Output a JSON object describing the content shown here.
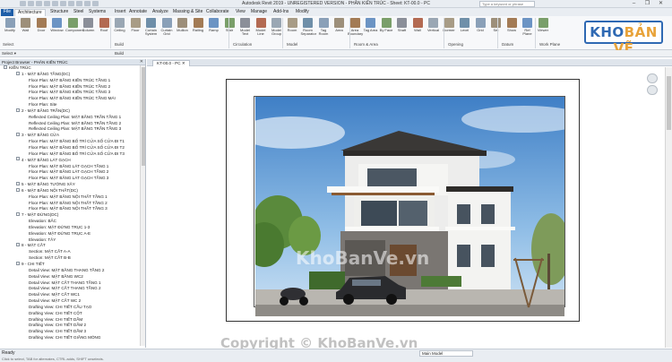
{
  "app": {
    "title": "Autodesk Revit 2019 - UNREGISTERED VERSION - PHÂN KIẾN TRÚC - Sheet: KT-00.0 - PC",
    "search_placeholder": "Type a keyword or phrase"
  },
  "window_controls": {
    "minimize": "–",
    "restore": "❐",
    "close": "✕"
  },
  "tabs": [
    "File",
    "Architecture",
    "Structure",
    "Steel",
    "Systems",
    "Insert",
    "Annotate",
    "Analyze",
    "Massing & Site",
    "Collaborate",
    "View",
    "Manage",
    "Add-Ins",
    "Modify"
  ],
  "active_tab": "Architecture",
  "ribbon": {
    "buttons": [
      "Modify",
      "Wall",
      "Door",
      "Window",
      "Component",
      "Column",
      "Roof",
      "Ceiling",
      "Floor",
      "Curtain System",
      "Curtain Grid",
      "Mullion",
      "Railing",
      "Ramp",
      "Stair",
      "Model Text",
      "Model Line",
      "Model Group",
      "Room",
      "Room Separator",
      "Tag Room",
      "Area",
      "Area Boundary",
      "Tag Area",
      "By Face",
      "Shaft",
      "Wall",
      "Vertical",
      "Dormer",
      "Level",
      "Grid",
      "Set",
      "Show",
      "Ref Plane",
      "Viewer"
    ],
    "groups": [
      "Select",
      "Build",
      "Circulation",
      "Model",
      "Room & Area",
      "Opening",
      "Datum",
      "Work Plane"
    ]
  },
  "options_bar": {
    "select_label": "Select ▾",
    "build_label": "Build"
  },
  "project_browser": {
    "title": "Project Browser - PHÂN KIẾN TRÚC",
    "items": [
      {
        "label": "KIẾN TRÚC",
        "level": 0
      },
      {
        "label": "1 - MẶT BẰNG TẦNG(DC)",
        "level": 1
      },
      {
        "label": "Floor Plan: MẶT BẰNG KIẾN TRÚC TẦNG 1",
        "level": 2
      },
      {
        "label": "Floor Plan: MẶT BẰNG KIẾN TRÚC TẦNG 2",
        "level": 2
      },
      {
        "label": "Floor Plan: MẶT BẰNG KIẾN TRÚC TẦNG 3",
        "level": 2
      },
      {
        "label": "Floor Plan: MẶT BẰNG KIẾN TRÚC TẦNG MÁI",
        "level": 2
      },
      {
        "label": "Floor Plan: Site",
        "level": 2
      },
      {
        "label": "2 - MẶT BẰNG TRẦN(DC)",
        "level": 1
      },
      {
        "label": "Reflected Ceiling Plan: MẶT BẰNG TRẦN TẦNG 1",
        "level": 2
      },
      {
        "label": "Reflected Ceiling Plan: MẶT BẰNG TRẦN TẦNG 2",
        "level": 2
      },
      {
        "label": "Reflected Ceiling Plan: MẶT BẰNG TRẦN TẦNG 3",
        "level": 2
      },
      {
        "label": "3 - MẶT BẰNG CỬA",
        "level": 1
      },
      {
        "label": "Floor Plan: MẶT BẰNG BỐ TRÍ CỬA SỐ CỬA ĐI T1",
        "level": 2
      },
      {
        "label": "Floor Plan: MẶT BẰNG BỐ TRÍ CỬA SỐ CỬA ĐI T2",
        "level": 2
      },
      {
        "label": "Floor Plan: MẶT BẰNG BỐ TRÍ CỬA SỐ CỬA ĐI T3",
        "level": 2
      },
      {
        "label": "4 - MẶT BẰNG LÁT GẠCH",
        "level": 1
      },
      {
        "label": "Floor Plan: MẶT BẰNG LÁT GẠCH TẦNG 1",
        "level": 2
      },
      {
        "label": "Floor Plan: MẶT BẰNG LÁT GẠCH TẦNG 2",
        "level": 2
      },
      {
        "label": "Floor Plan: MẶT BẰNG LÁT GẠCH TẦNG 3",
        "level": 2
      },
      {
        "label": "5 - MẶT BẰNG TƯỜNG XÂY",
        "level": 1
      },
      {
        "label": "6 - MẶT BẰNG NỘI THẤT(DC)",
        "level": 1
      },
      {
        "label": "Floor Plan: MẶT BẰNG NỘI THẤT TẦNG 1",
        "level": 2
      },
      {
        "label": "Floor Plan: MẶT BẰNG NỘI THẤT TẦNG 2",
        "level": 2
      },
      {
        "label": "Floor Plan: MẶT BẰNG NỘI THẤT TẦNG 3",
        "level": 2
      },
      {
        "label": "7 - MẶT ĐỨNG(DC)",
        "level": 1
      },
      {
        "label": "Elevation: BẮC",
        "level": 2
      },
      {
        "label": "Elevation: MẶT ĐỨNG TRỤC 1-3",
        "level": 2
      },
      {
        "label": "Elevation: MẶT ĐỨNG TRỤC A-E",
        "level": 2
      },
      {
        "label": "Elevation: TÂY",
        "level": 2
      },
      {
        "label": "8 - MẶT CẮT",
        "level": 1
      },
      {
        "label": "Section: MẶT CẮT A-A",
        "level": 2
      },
      {
        "label": "Section: MẶT CẮT B-B",
        "level": 2
      },
      {
        "label": "9 - CHI TIẾT",
        "level": 1
      },
      {
        "label": "Detail View: MẶT BẰNG THANG TẦNG 2",
        "level": 2
      },
      {
        "label": "Detail View: MẶT BẰNG WC2",
        "level": 2
      },
      {
        "label": "Detail View: MẶT CẮT THANG TẦNG 1",
        "level": 2
      },
      {
        "label": "Detail View: MẶT CẮT THANG TẦNG 2",
        "level": 2
      },
      {
        "label": "Detail View: MẶT CẮT WC1",
        "level": 2
      },
      {
        "label": "Detail View: MẶT CẮT WC 2",
        "level": 2
      },
      {
        "label": "Drafting View: CHI TIẾT CẦU TẠO",
        "level": 2
      },
      {
        "label": "Drafting View: CHI TIẾT CỘT",
        "level": 2
      },
      {
        "label": "Drafting View: CHI TIẾT DẦM",
        "level": 2
      },
      {
        "label": "Drafting View: CHI TIẾT DẦM 2",
        "level": 2
      },
      {
        "label": "Drafting View: CHI TIẾT DẦM 3",
        "level": 2
      },
      {
        "label": "Drafting View: CHI TIẾT GIẰNG MÓNG",
        "level": 2
      }
    ]
  },
  "view_tab": {
    "label": "KT-00.0 - PC",
    "close": "✕"
  },
  "logo": {
    "text_main": "KHO",
    "text_accent": "BẢN VẼ"
  },
  "watermark": {
    "center": "KhoBanVe.vn",
    "bottom": "Copyright © KhoBanVe.vn"
  },
  "status": {
    "ready": "Ready",
    "model": "Main Model",
    "hint": "Click to select, TAB for alternates, CTRL adds, SHIFT unselects."
  },
  "colors": {
    "accent": "#1f5ea8",
    "logo_blue": "#2f69b3",
    "logo_orange": "#e8a33a"
  }
}
